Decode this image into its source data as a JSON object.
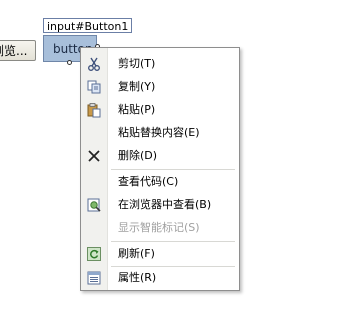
{
  "designer": {
    "left_button_text": "浏览...",
    "selected_tag": "input#Button1",
    "selected_button_text": "button"
  },
  "context_menu": {
    "items": [
      {
        "label": "剪切(T)",
        "icon": "scissors-icon",
        "enabled": true
      },
      {
        "label": "复制(Y)",
        "icon": "copy-icon",
        "enabled": true
      },
      {
        "label": "粘贴(P)",
        "icon": "paste-icon",
        "enabled": true
      },
      {
        "label": "粘贴替换内容(E)",
        "icon": "",
        "enabled": true
      },
      {
        "label": "删除(D)",
        "icon": "delete-x-icon",
        "enabled": true
      },
      {
        "label": "查看代码(C)",
        "icon": "",
        "enabled": true
      },
      {
        "label": "在浏览器中查看(B)",
        "icon": "browser-preview-icon",
        "enabled": true
      },
      {
        "label": "显示智能标记(S)",
        "icon": "",
        "enabled": false
      },
      {
        "label": "刷新(F)",
        "icon": "refresh-icon",
        "enabled": true
      },
      {
        "label": "属性(R)",
        "icon": "properties-icon",
        "enabled": true
      }
    ]
  }
}
